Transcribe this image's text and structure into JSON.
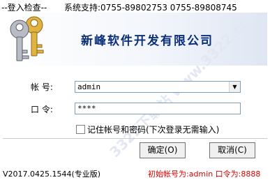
{
  "titlebar": {
    "title": "--登入检查--",
    "support": "系统支持:0755-89802753 0755-89808745"
  },
  "banner": {
    "company": "新峰软件开发有限公司",
    "watermark": "3322下载站 www.3322.cc"
  },
  "form": {
    "account_label": "帐    号:",
    "account_value": "admin",
    "password_label": "口    令:",
    "password_value": "****",
    "remember_label": "记住帐号和密码(下次登录无需输入)"
  },
  "buttons": {
    "ok": "确定(O)",
    "cancel": "取消(C)"
  },
  "footer": {
    "version": "V2017.0425.1544(专业版)",
    "initial": "初始帐号为:admin 口令为:8888"
  },
  "colors": {
    "company_text": "#0b2e7a",
    "initial_text": "#e00000",
    "input_border": "#7f9db9"
  }
}
